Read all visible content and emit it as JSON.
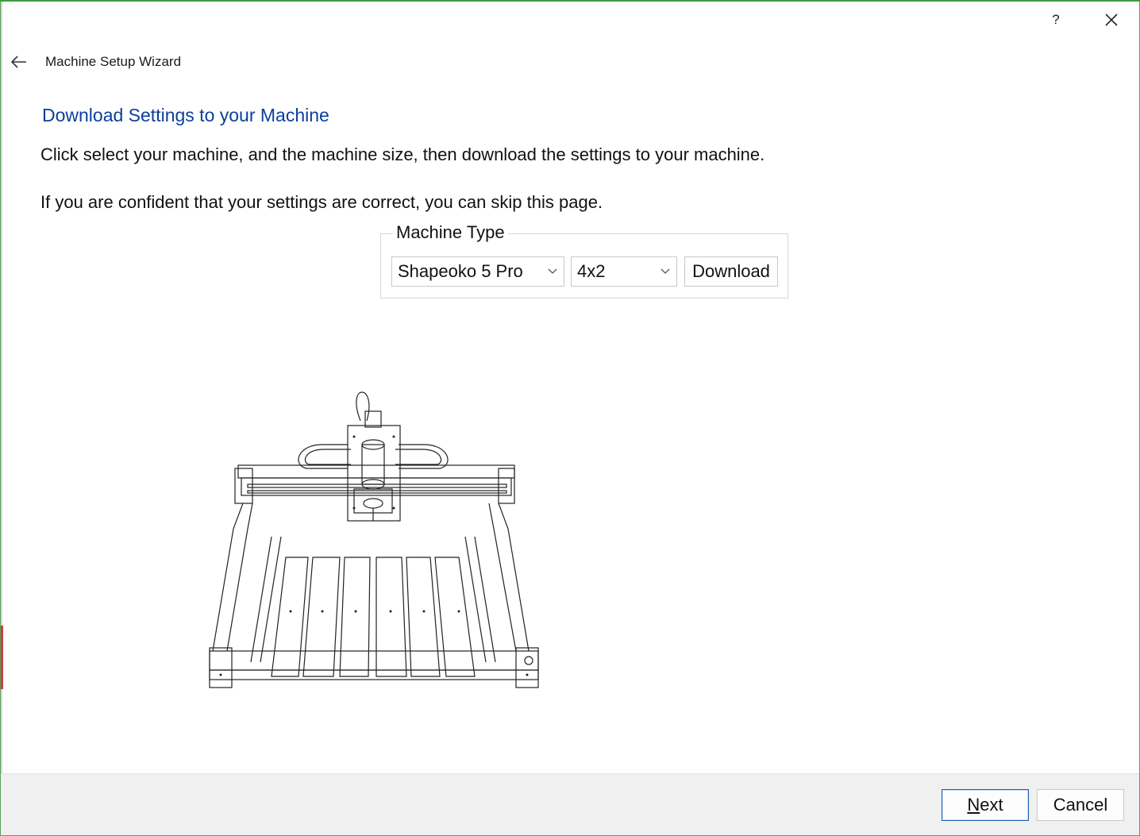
{
  "window": {
    "help_label": "?",
    "close_label": "✕"
  },
  "header": {
    "title": "Machine Setup Wizard",
    "back_icon": "arrow-left-icon"
  },
  "page": {
    "section_title": "Download Settings to your Machine",
    "instruction": "Click select your machine, and the machine size, then download the settings to your machine.",
    "skip_note": "If you are confident that your settings are correct, you can skip this page."
  },
  "machine_type": {
    "group_label": "Machine Type",
    "machine_selected": "Shapeoko 5 Pro",
    "size_selected": "4x2",
    "download_label": "Download"
  },
  "footer": {
    "next_mnemonic": "N",
    "next_rest": "ext",
    "cancel_label": "Cancel"
  },
  "colors": {
    "title_blue": "#0c3e9a",
    "accent_border": "#1a5fb4",
    "footer_bg": "#f0f0f0"
  }
}
